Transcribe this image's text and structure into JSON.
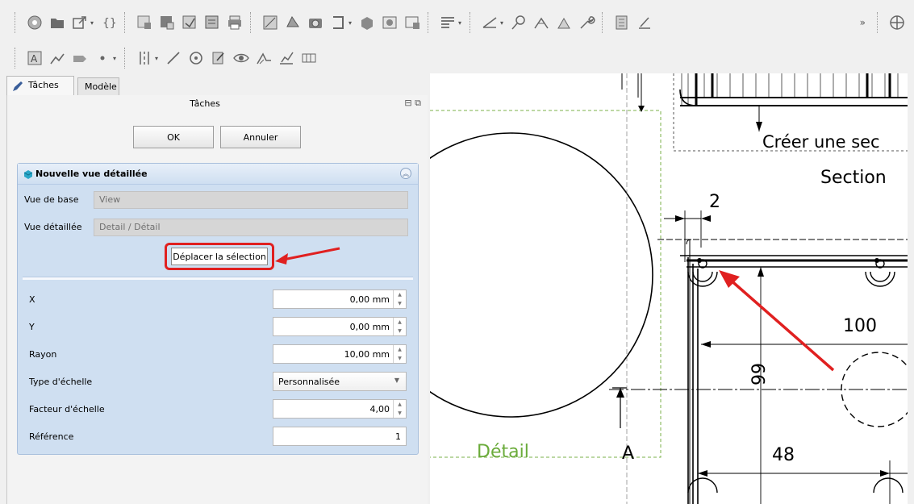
{
  "tabs": [
    {
      "label": "Tâches",
      "active": true
    },
    {
      "label": "Modèle",
      "active": false
    }
  ],
  "panel": {
    "title": "Tâches",
    "ok_label": "OK",
    "cancel_label": "Annuler"
  },
  "detail_view": {
    "header": "Nouvelle vue détaillée",
    "base_view_label": "Vue de base",
    "base_view_value": "View",
    "detail_view_label": "Vue détaillée",
    "detail_view_value": "Detail / Détail",
    "move_selection_label": "Déplacer la sélection",
    "fields": [
      {
        "label": "X",
        "value": "0,00 mm",
        "kind": "spin"
      },
      {
        "label": "Y",
        "value": "0,00 mm",
        "kind": "spin"
      },
      {
        "label": "Rayon",
        "value": "10,00 mm",
        "kind": "spin"
      },
      {
        "label": "Type d'échelle",
        "value": "Personnalisée",
        "kind": "combo"
      },
      {
        "label": "Facteur d'échelle",
        "value": "4,00",
        "kind": "spin"
      },
      {
        "label": "Référence",
        "value": "1",
        "kind": "text"
      }
    ]
  },
  "drawing": {
    "section_create_text": "Créer une sec",
    "section_text": "Section",
    "dim_2": "2",
    "dim_100": "100",
    "dim_99": "99",
    "dim_48": "48",
    "detail_label": "Détail",
    "section_letter": "A"
  },
  "colors": {
    "accent_red": "#e02020",
    "detail_green": "#6aab3a",
    "panel_blue": "#cfdff1"
  }
}
